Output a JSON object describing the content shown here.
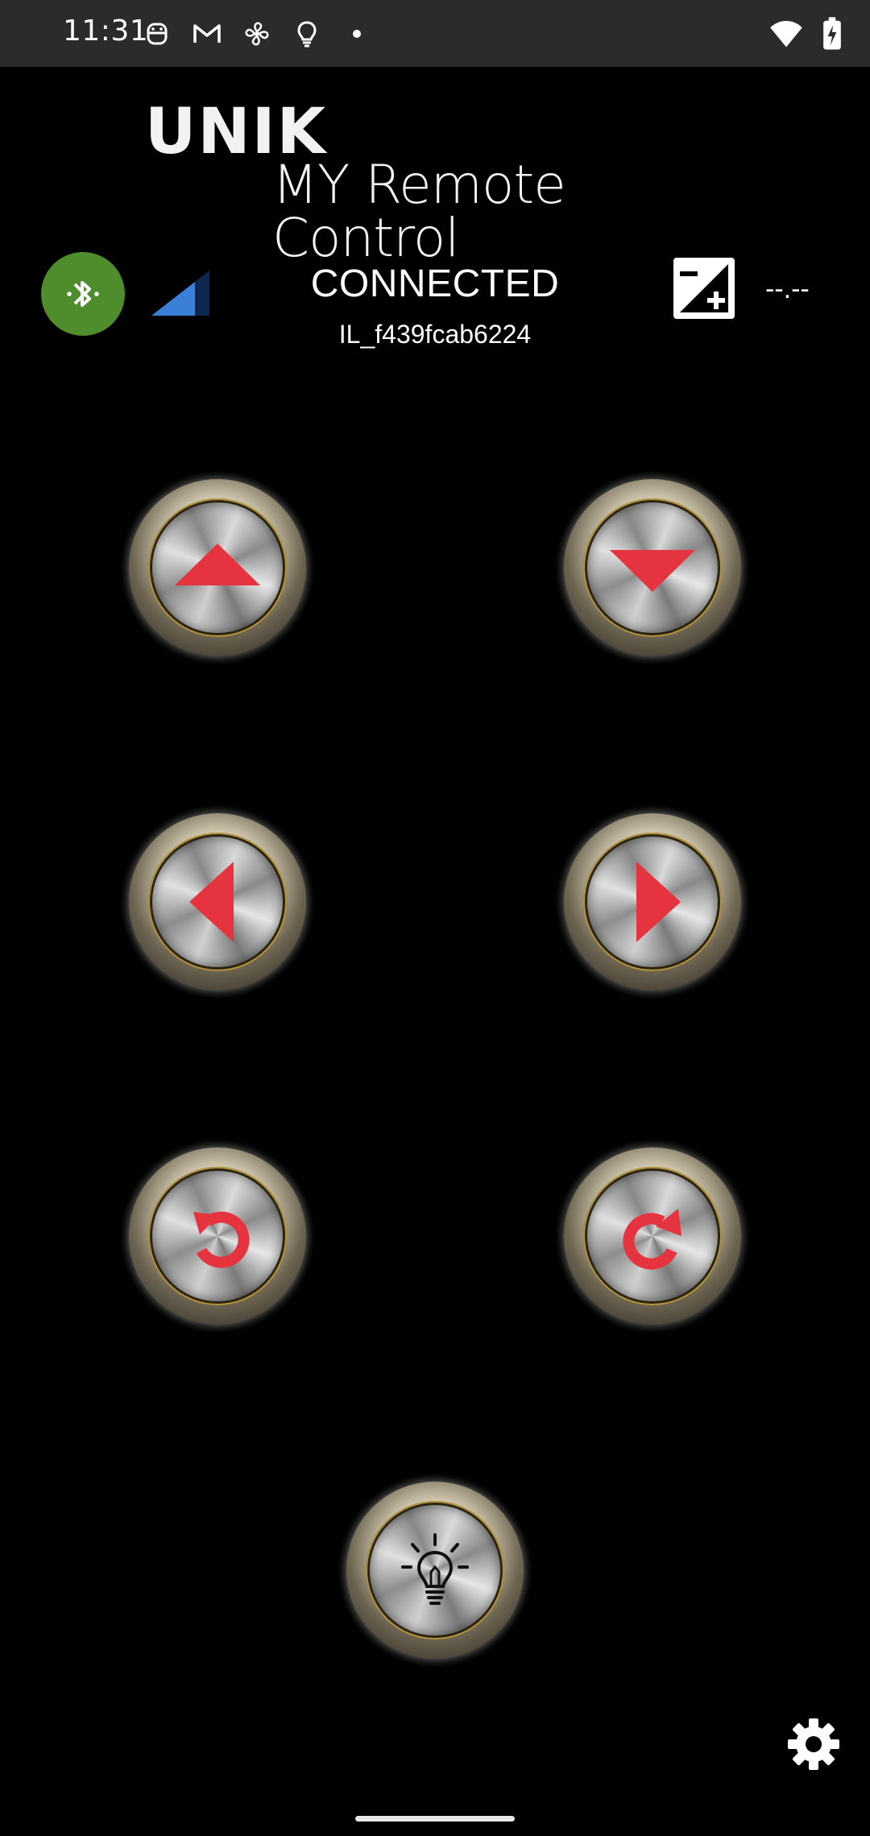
{
  "status_bar": {
    "time": "11:31",
    "left_icons": [
      "android-face-icon",
      "gmail-icon",
      "fan-icon",
      "lightbulb-icon",
      "dot-icon"
    ],
    "right_icons": [
      "wifi-icon",
      "battery-charging-icon"
    ]
  },
  "logo": {
    "brand": "UNIK",
    "subtitle": "MY Remote Control"
  },
  "connection": {
    "status": "CONNECTED",
    "device_id": "IL_f439fcab6224",
    "bluetooth_color": "#4f8c2b",
    "signal_color": "#3a7fd8"
  },
  "exposure": {
    "value": "--.--"
  },
  "controls": {
    "arrow_color": "#e5343f",
    "buttons": [
      "up",
      "down",
      "left",
      "right",
      "rotate-counterclockwise",
      "rotate-clockwise",
      "light"
    ]
  }
}
